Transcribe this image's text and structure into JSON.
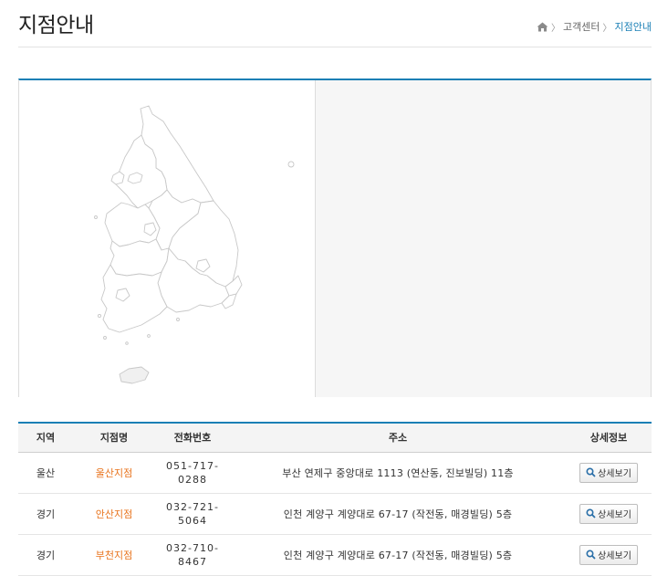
{
  "header": {
    "title": "지점안내",
    "breadcrumb": [
      "고객센터",
      "지점안내"
    ]
  },
  "table": {
    "columns": [
      "지역",
      "지점명",
      "전화번호",
      "주소",
      "상세정보"
    ],
    "rows": [
      {
        "region": "울산",
        "branch": "울산지점",
        "phone_line1": "051-717-",
        "phone_line2": "0288",
        "address": "부산 연제구 중앙대로 1113 (연산동, 진보빌딩) 11층",
        "detail": "상세보기"
      },
      {
        "region": "경기",
        "branch": "안산지점",
        "phone_line1": "032-721-",
        "phone_line2": "5064",
        "address": "인천 계양구 계양대로 67-17 (작전동, 매경빌딩) 5층",
        "detail": "상세보기"
      },
      {
        "region": "경기",
        "branch": "부천지점",
        "phone_line1": "032-710-",
        "phone_line2": "8467",
        "address": "인천 계양구 계양대로 67-17 (작전동, 매경빌딩) 5층",
        "detail": "상세보기"
      }
    ]
  },
  "colors": {
    "accent": "#1a7fb5",
    "branch_link": "#e8731c"
  },
  "icons": {
    "home": "home-icon",
    "search": "search-icon"
  }
}
